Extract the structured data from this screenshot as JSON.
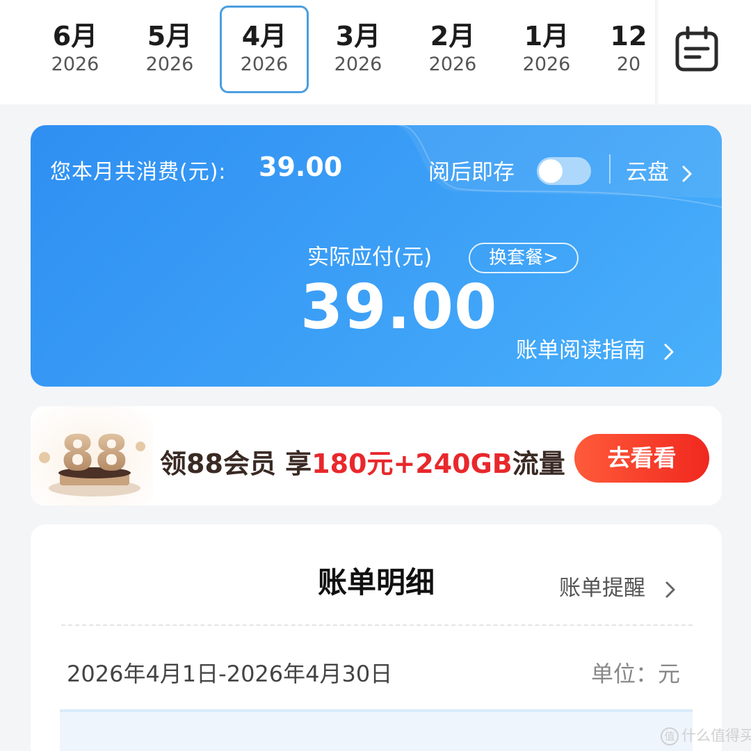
{
  "months": [
    {
      "month": "6月",
      "year": "2026",
      "selected": false
    },
    {
      "month": "5月",
      "year": "2026",
      "selected": false
    },
    {
      "month": "4月",
      "year": "2026",
      "selected": true
    },
    {
      "month": "3月",
      "year": "2026",
      "selected": false
    },
    {
      "month": "2月",
      "year": "2026",
      "selected": false
    },
    {
      "month": "1月",
      "year": "2026",
      "selected": false
    },
    {
      "month": "12",
      "year": "20",
      "selected": false
    }
  ],
  "calendar_icon": "calendar-icon",
  "summary": {
    "total_label": "您本月共消费(元):",
    "total_value": "39.00",
    "autosave_label": "阅后即存",
    "autosave_on": false,
    "cloud_label": "云盘",
    "actual_label": "实际应付(元)",
    "change_plan_label": "换套餐>",
    "actual_value": "39.00",
    "guide_label": "账单阅读指南"
  },
  "banner": {
    "badge_text": "88",
    "text_part1": "领88会员 享",
    "text_highlight": "180元+240GB",
    "text_part2": "流量",
    "button_label": "去看看"
  },
  "details": {
    "title": "账单明细",
    "reminder_label": "账单提醒",
    "period": "2026年4月1日-2026年4月30日",
    "unit": "单位：元"
  },
  "watermark": {
    "logo": "值",
    "text": "什么值得买"
  },
  "colors": {
    "accent_blue": "#3a9af4",
    "selected_border": "#4a9fe0",
    "banner_red": "#e8282c",
    "button_red": "#f0281f"
  }
}
